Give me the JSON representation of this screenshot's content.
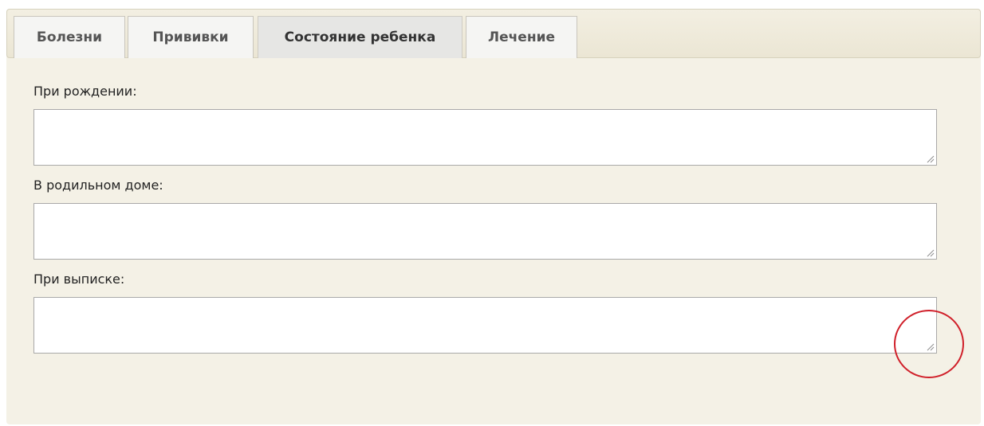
{
  "tabs": [
    {
      "label": "Болезни",
      "active": false
    },
    {
      "label": "Прививки",
      "active": false
    },
    {
      "label": "Состояние ребенка",
      "active": true
    },
    {
      "label": "Лечение",
      "active": false
    }
  ],
  "fields": [
    {
      "label": "При рождении:",
      "value": ""
    },
    {
      "label": "В родильном доме:",
      "value": ""
    },
    {
      "label": "При выписке:",
      "value": ""
    }
  ],
  "colors": {
    "panel_background": "#f4f1e6",
    "active_tab": "#e6e6e4",
    "inactive_tab": "#f5f5f3",
    "highlight_circle": "#d0202a"
  },
  "icons": {
    "resize_grip": "resize-grip-icon",
    "highlight": "red-circle-annotation"
  }
}
